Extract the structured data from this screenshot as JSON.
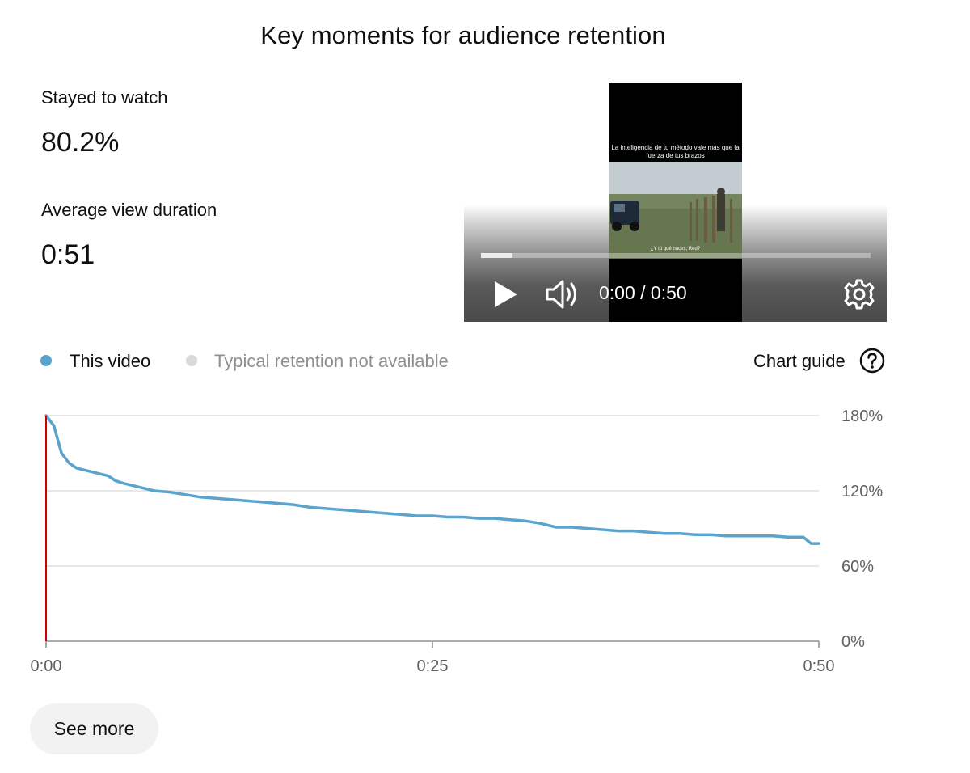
{
  "header": {
    "title": "Key moments for audience retention"
  },
  "metrics": {
    "stayed_label": "Stayed to watch",
    "stayed_value": "80.2%",
    "avd_label": "Average view duration",
    "avd_value": "0:51"
  },
  "player": {
    "caption": "La inteligencia de tu método vale más que la fuerza de tus brazos",
    "subtitle": "¿Y tú qué haces, Red?",
    "time": "0:00 / 0:50",
    "progress_buffered": 0.08,
    "icons": {
      "play": "play-icon",
      "volume": "volume-icon",
      "settings": "gear-icon"
    }
  },
  "legend": {
    "this_video": "This video",
    "typical": "Typical retention not available",
    "chart_guide": "Chart guide",
    "help_icon": "help-circle-icon",
    "colors": {
      "this_video": "#5aa3cc",
      "typical": "#d9d9d9"
    }
  },
  "chart_data": {
    "type": "line",
    "title": "",
    "xlabel": "",
    "ylabel": "",
    "x_ticks": [
      "0:00",
      "0:25",
      "0:50"
    ],
    "y_ticks": [
      "0%",
      "60%",
      "120%",
      "180%"
    ],
    "xlim": [
      0,
      50
    ],
    "ylim": [
      0,
      180
    ],
    "grid": true,
    "legend_position": "top-left",
    "marker_x": 0,
    "marker_color": "#cc0000",
    "series": [
      {
        "name": "This video",
        "color": "#5aa3cc",
        "x": [
          0,
          0.5,
          1,
          1.5,
          2,
          3,
          4,
          4.5,
          5,
          6,
          7,
          8,
          9,
          10,
          11,
          12,
          13,
          14,
          15,
          16,
          17,
          18,
          19,
          20,
          21,
          22,
          23,
          24,
          25,
          26,
          27,
          28,
          29,
          30,
          31,
          32,
          33,
          34,
          35,
          36,
          37,
          38,
          39,
          40,
          41,
          42,
          43,
          44,
          45,
          46,
          47,
          48,
          49,
          49.5,
          50
        ],
        "values": [
          180,
          172,
          150,
          142,
          138,
          135,
          132,
          128,
          126,
          123,
          120,
          119,
          117,
          115,
          114,
          113,
          112,
          111,
          110,
          109,
          107,
          106,
          105,
          104,
          103,
          102,
          101,
          100,
          100,
          99,
          99,
          98,
          98,
          97,
          96,
          94,
          91,
          91,
          90,
          89,
          88,
          88,
          87,
          86,
          86,
          85,
          85,
          84,
          84,
          84,
          84,
          83,
          83,
          78,
          78
        ]
      }
    ]
  },
  "footer": {
    "see_more": "See more"
  }
}
